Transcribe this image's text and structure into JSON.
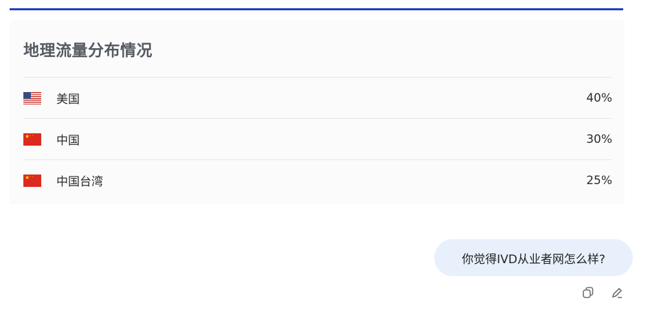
{
  "card": {
    "title": "地理流量分布情况",
    "rows": [
      {
        "flag": "us-flag-icon",
        "country": "美国",
        "percent": "40%"
      },
      {
        "flag": "china-flag-icon",
        "country": "中国",
        "percent": "30%"
      },
      {
        "flag": "china-flag-icon",
        "country": "中国台湾",
        "percent": "25%"
      }
    ]
  },
  "chat": {
    "user_message": "你觉得IVD从业者网怎么样?",
    "actions": [
      "copy-icon",
      "edit-icon"
    ]
  },
  "colors": {
    "accent_rule": "#1f3fbf",
    "bubble_bg": "#e8f1fb"
  }
}
